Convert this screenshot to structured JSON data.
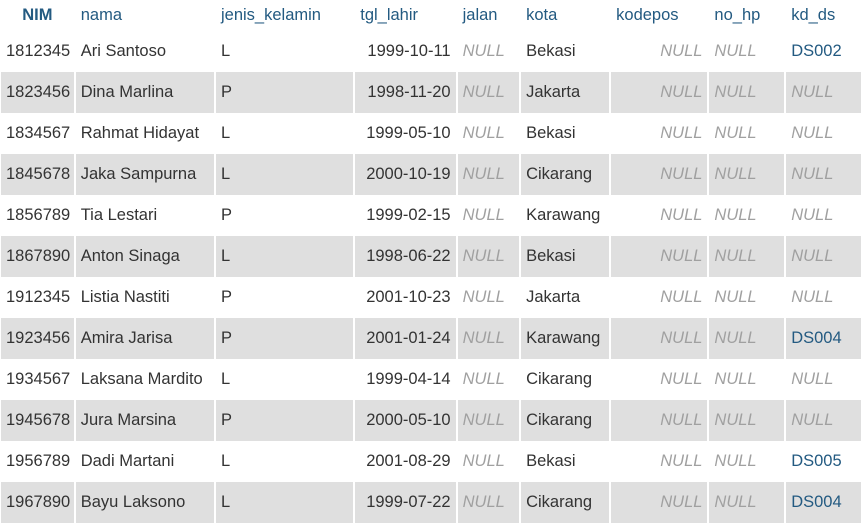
{
  "table": {
    "columns": [
      "NIM",
      "nama",
      "jenis_kelamin",
      "tgl_lahir",
      "jalan",
      "kota",
      "kodepos",
      "no_hp",
      "kd_ds"
    ],
    "rows": [
      [
        "1812345",
        "Ari Santoso",
        "L",
        "1999-10-11",
        "NULL",
        "Bekasi",
        "NULL",
        "NULL",
        "DS002"
      ],
      [
        "1823456",
        "Dina Marlina",
        "P",
        "1998-11-20",
        "NULL",
        "Jakarta",
        "NULL",
        "NULL",
        "NULL"
      ],
      [
        "1834567",
        "Rahmat Hidayat",
        "L",
        "1999-05-10",
        "NULL",
        "Bekasi",
        "NULL",
        "NULL",
        "NULL"
      ],
      [
        "1845678",
        "Jaka Sampurna",
        "L",
        "2000-10-19",
        "NULL",
        "Cikarang",
        "NULL",
        "NULL",
        "NULL"
      ],
      [
        "1856789",
        "Tia Lestari",
        "P",
        "1999-02-15",
        "NULL",
        "Karawang",
        "NULL",
        "NULL",
        "NULL"
      ],
      [
        "1867890",
        "Anton Sinaga",
        "L",
        "1998-06-22",
        "NULL",
        "Bekasi",
        "NULL",
        "NULL",
        "NULL"
      ],
      [
        "1912345",
        "Listia Nastiti",
        "P",
        "2001-10-23",
        "NULL",
        "Jakarta",
        "NULL",
        "NULL",
        "NULL"
      ],
      [
        "1923456",
        "Amira Jarisa",
        "P",
        "2001-01-24",
        "NULL",
        "Karawang",
        "NULL",
        "NULL",
        "DS004"
      ],
      [
        "1934567",
        "Laksana Mardito",
        "L",
        "1999-04-14",
        "NULL",
        "Cikarang",
        "NULL",
        "NULL",
        "NULL"
      ],
      [
        "1945678",
        "Jura Marsina",
        "P",
        "2000-05-10",
        "NULL",
        "Cikarang",
        "NULL",
        "NULL",
        "NULL"
      ],
      [
        "1956789",
        "Dadi Martani",
        "L",
        "2001-08-29",
        "NULL",
        "Bekasi",
        "NULL",
        "NULL",
        "DS005"
      ],
      [
        "1967890",
        "Bayu Laksono",
        "L",
        "1999-07-22",
        "NULL",
        "Cikarang",
        "NULL",
        "NULL",
        "DS004"
      ]
    ]
  },
  "colors": {
    "header_link": "#235a81",
    "row_alt": "#dfdfdf",
    "null_text": "#a0a0a0",
    "fk_link": "#235a81"
  }
}
